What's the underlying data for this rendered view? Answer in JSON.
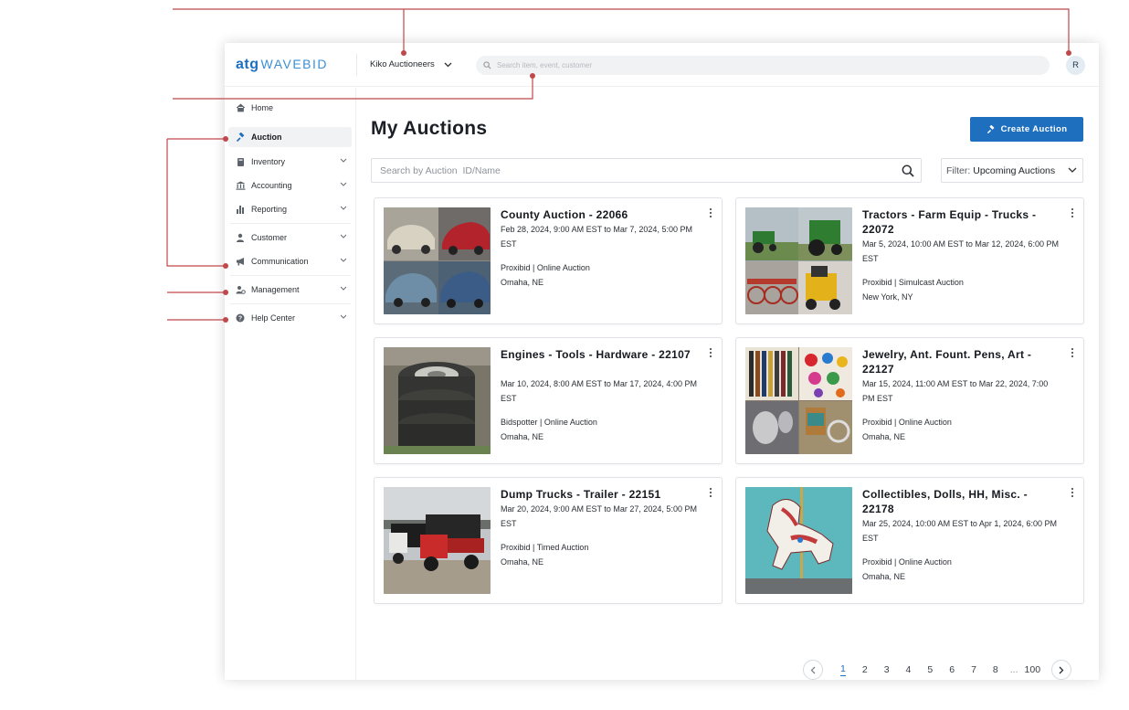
{
  "app": {
    "logo_atg": "atg",
    "logo_wavebid": "WAVEBID",
    "org_name": "Kiko Auctioneers",
    "top_search_placeholder": "Search item, event, customer",
    "avatar_initial": "R"
  },
  "sidebar": {
    "items": [
      {
        "label": "Home",
        "icon": "home-icon"
      },
      {
        "label": "Auction",
        "icon": "gavel-icon"
      },
      {
        "label": "Inventory",
        "icon": "book-icon"
      },
      {
        "label": "Accounting",
        "icon": "bank-icon"
      },
      {
        "label": "Reporting",
        "icon": "bar-chart-icon"
      },
      {
        "label": "Customer",
        "icon": "person-icon"
      },
      {
        "label": "Communication",
        "icon": "megaphone-icon"
      },
      {
        "label": "Management",
        "icon": "user-cog-icon"
      },
      {
        "label": "Help Center",
        "icon": "help-icon"
      }
    ]
  },
  "main": {
    "title": "My Auctions",
    "create_label": "Create Auction",
    "search_placeholder": "Search by Auction  ID/Name",
    "filter_label": "Filter:",
    "filter_value": "Upcoming Auctions"
  },
  "auctions": [
    {
      "title": "County Auction - 22066",
      "dates": "Feb 28, 2024, 9:00 AM EST to Mar 7, 2024, 5:00 PM EST",
      "platform": "Proxibid | Online Auction",
      "location": "Omaha, NE",
      "image": "cars-photo"
    },
    {
      "title": "Tractors - Farm Equip - Trucks - 22072",
      "dates": "Mar 5, 2024, 10:00 AM EST to Mar 12, 2024, 6:00 PM EST",
      "platform": "Proxibid | Simulcast Auction",
      "location": "New York, NY",
      "image": "tractors-photo"
    },
    {
      "title": "Engines - Tools - Hardware - 22107",
      "dates": "Mar 10, 2024, 8:00 AM EST to Mar 17, 2024, 4:00 PM EST",
      "platform": "Bidspotter | Online Auction",
      "location": "Omaha, NE",
      "image": "tires-photo"
    },
    {
      "title": "Jewelry, Ant. Fount. Pens, Art - 22127",
      "dates": "Mar 15, 2024, 11:00 AM EST to Mar 22, 2024, 7:00 PM EST",
      "platform": "Proxibid | Online Auction",
      "location": "Omaha, NE",
      "image": "jewelry-photo"
    },
    {
      "title": "Dump Trucks - Trailer - 22151",
      "dates": "Mar 20, 2024, 9:00 AM EST to Mar 27, 2024, 5:00 PM EST",
      "platform": "Proxibid | Timed Auction",
      "location": "Omaha, NE",
      "image": "dump-trucks-photo"
    },
    {
      "title": "Collectibles, Dolls, HH, Misc. - 22178",
      "dates": "Mar 25, 2024, 10:00 AM EST to Apr 1, 2024, 6:00 PM EST",
      "platform": "Proxibid | Online Auction",
      "location": "Omaha, NE",
      "image": "carousel-horse-photo"
    }
  ],
  "pagination": {
    "pages": [
      "1",
      "2",
      "3",
      "4",
      "5",
      "6",
      "7",
      "8"
    ],
    "ellipsis": "...",
    "last": "100",
    "current": "1"
  },
  "colors": {
    "accent": "#1f6fbf",
    "callout": "#c0474b"
  }
}
